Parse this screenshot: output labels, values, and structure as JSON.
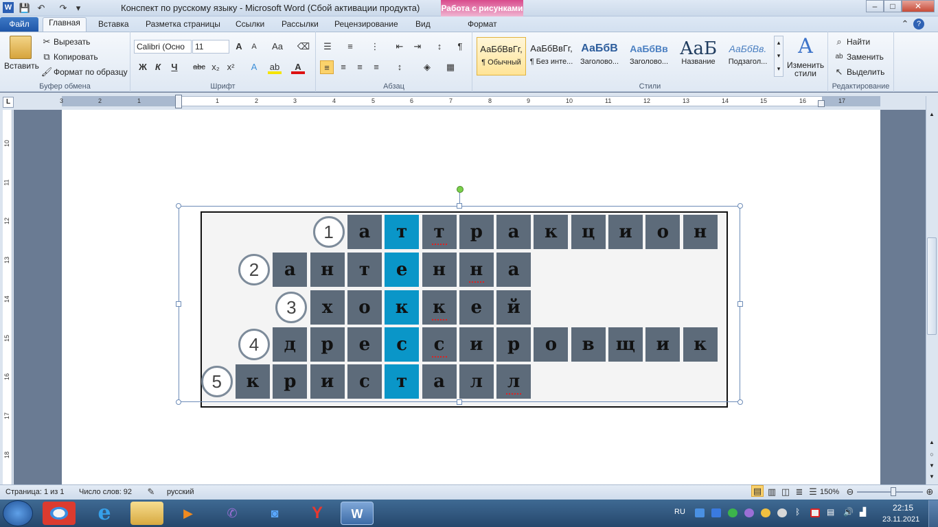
{
  "window": {
    "title": "Конспект по русскому языку  -  Microsoft Word (Сбой активации продукта)",
    "context_tool": "Работа с рисунками",
    "controls": {
      "minimize": "–",
      "maximize": "□",
      "close": "✕"
    }
  },
  "tabs": [
    "Файл",
    "Главная",
    "Вставка",
    "Разметка страницы",
    "Ссылки",
    "Рассылки",
    "Рецензирование",
    "Вид",
    "Формат"
  ],
  "ribbon": {
    "clipboard": {
      "paste": "Вставить",
      "cut": "Вырезать",
      "copy": "Копировать",
      "format_painter": "Формат по образцу",
      "label": "Буфер обмена"
    },
    "font": {
      "name": "Calibri (Осно",
      "size": "11",
      "label": "Шрифт",
      "bold": "Ж",
      "italic": "К",
      "underline": "Ч"
    },
    "paragraph": {
      "label": "Абзац"
    },
    "styles": {
      "label": "Стили",
      "items": [
        {
          "sample": "АаБбВвГг,",
          "name": "¶ Обычный"
        },
        {
          "sample": "АаБбВвГг,",
          "name": "¶ Без инте..."
        },
        {
          "sample": "АаБбВ",
          "name": "Заголово..."
        },
        {
          "sample": "АаБбВв",
          "name": "Заголово..."
        },
        {
          "sample": "АаБ",
          "name": "Название"
        },
        {
          "sample": "АаБбВв.",
          "name": "Подзагол..."
        }
      ],
      "change_styles": "Изменить стили"
    },
    "editing": {
      "find": "Найти",
      "replace": "Заменить",
      "select": "Выделить",
      "label": "Редактирование"
    }
  },
  "ruler": {
    "h_numbers": [
      "3",
      "2",
      "1",
      "1",
      "2",
      "3",
      "4",
      "5",
      "6",
      "7",
      "8",
      "9",
      "10",
      "11",
      "12",
      "13",
      "14",
      "15",
      "16",
      "17"
    ],
    "v_numbers": [
      "10",
      "11",
      "12",
      "13",
      "14",
      "15",
      "16",
      "17",
      "18"
    ]
  },
  "crossword": {
    "rows": [
      {
        "number": "1",
        "letters": [
          "а",
          "т",
          "т",
          "р",
          "а",
          "к",
          "ц",
          "и",
          "о",
          "н"
        ]
      },
      {
        "number": "2",
        "letters": [
          "а",
          "н",
          "т",
          "е",
          "н",
          "н",
          "а"
        ]
      },
      {
        "number": "3",
        "letters": [
          "х",
          "о",
          "к",
          "к",
          "е",
          "й"
        ]
      },
      {
        "number": "4",
        "letters": [
          "д",
          "р",
          "е",
          "с",
          "с",
          "и",
          "р",
          "о",
          "в",
          "щ",
          "и",
          "к"
        ]
      },
      {
        "number": "5",
        "letters": [
          "к",
          "р",
          "и",
          "с",
          "т",
          "а",
          "л",
          "л"
        ]
      }
    ]
  },
  "status": {
    "page": "Страница: 1 из 1",
    "words": "Число слов: 92",
    "language": "русский",
    "zoom": "150%"
  },
  "taskbar": {
    "lang": "RU",
    "time": "22:15",
    "date": "23.11.2021"
  }
}
